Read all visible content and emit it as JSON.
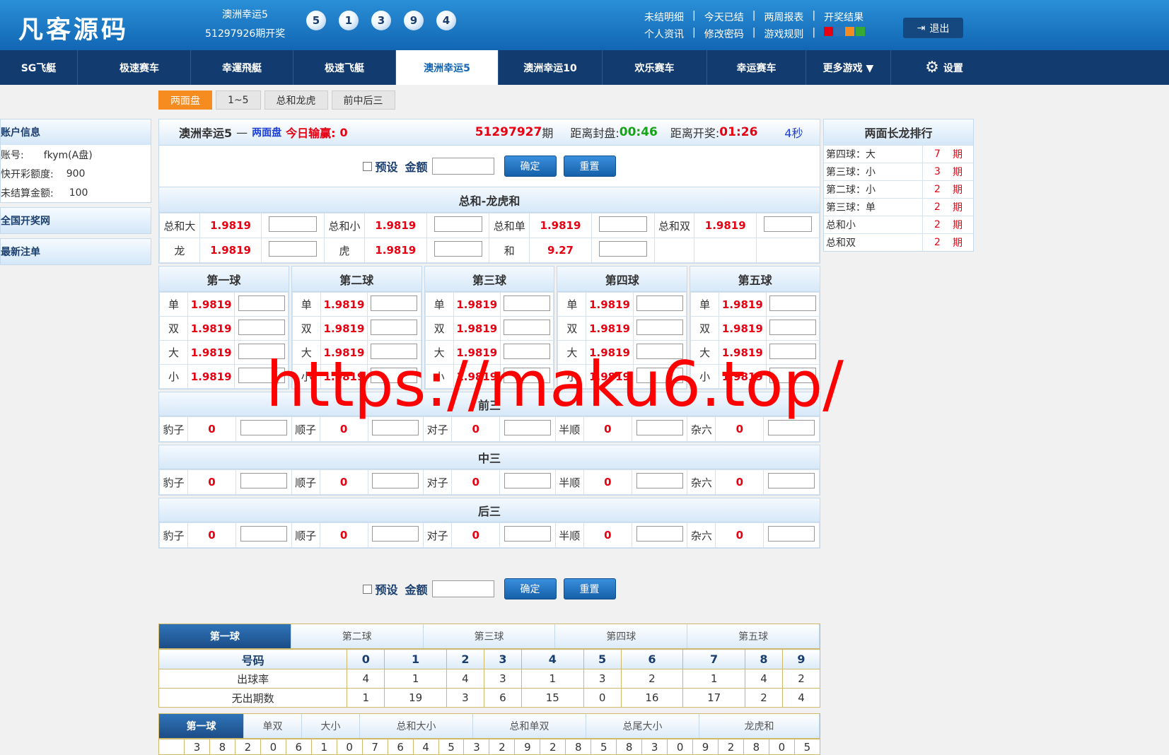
{
  "header": {
    "logo": "凡客源码",
    "lottery_name": "澳洲幸运5",
    "issue_text": "51297926期开奖",
    "balls": [
      "5",
      "1",
      "3",
      "9",
      "4"
    ],
    "links_row1": [
      "未结明细",
      "|",
      "今天已结",
      "|",
      "两周报表",
      "|",
      "开奖结果"
    ],
    "links_row2": [
      "个人资讯",
      "|",
      "修改密码",
      "|",
      "游戏规则",
      "|"
    ],
    "theme_colors": [
      "#e60012",
      "#2f74b9",
      "#f68b1f",
      "#39a935"
    ],
    "logout": "退出"
  },
  "nav": {
    "items": [
      "SG飞艇",
      "极速赛车",
      "幸運飛艇",
      "极速飞艇",
      "澳洲幸运5",
      "澳洲幸运10",
      "欢乐赛车",
      "幸运赛车",
      "更多游戏 ▼"
    ],
    "settings": "设置"
  },
  "subtabs": [
    "两面盘",
    "1~5",
    "总和龙虎",
    "前中后三"
  ],
  "left": {
    "account_title": "账户信息",
    "account_label": "账号:",
    "account_value": "fkym(A盘)",
    "credit_label": "快开彩额度:",
    "credit_value": "900",
    "unsettled_label": "未结算金额:",
    "unsettled_value": "100",
    "nav1": "全国开奖网",
    "nav2": "最新注单"
  },
  "main": {
    "game": "澳洲幸运5",
    "dash": "—",
    "mode": "两面盘",
    "today_label": "今日输赢:",
    "today_value": "0",
    "issue": "51297927",
    "issue_suffix": "期",
    "close_label": "距离封盘:",
    "close_time": "00:46",
    "draw_label": "距离开奖:",
    "draw_time": "01:26",
    "refresh": "4秒",
    "preset": "预设",
    "amount": "金额",
    "confirm": "确定",
    "reset": "重置"
  },
  "sum_section": {
    "title": "总和-龙虎和",
    "row1": [
      [
        "总和大",
        "1.9819"
      ],
      [
        "总和小",
        "1.9819"
      ],
      [
        "总和单",
        "1.9819"
      ],
      [
        "总和双",
        "1.9819"
      ]
    ],
    "row2": [
      [
        "龙",
        "1.9819"
      ],
      [
        "虎",
        "1.9819"
      ],
      [
        "和",
        "9.27"
      ]
    ]
  },
  "balls_section": {
    "titles": [
      "第一球",
      "第二球",
      "第三球",
      "第四球",
      "第五球"
    ],
    "labels": [
      "单",
      "双",
      "大",
      "小"
    ],
    "odds": "1.9819"
  },
  "three_sections": [
    {
      "title": "前三"
    },
    {
      "title": "中三"
    },
    {
      "title": "后三"
    }
  ],
  "three_items": [
    [
      "豹子",
      "0"
    ],
    [
      "顺子",
      "0"
    ],
    [
      "对子",
      "0"
    ],
    [
      "半顺",
      "0"
    ],
    [
      "杂六",
      "0"
    ]
  ],
  "long_dragon": {
    "title": "两面长龙排行",
    "rows": [
      [
        "第四球：大",
        "7",
        "期"
      ],
      [
        "第三球：小",
        "3",
        "期"
      ],
      [
        "第二球：小",
        "2",
        "期"
      ],
      [
        "第三球：单",
        "2",
        "期"
      ],
      [
        "总和小",
        "2",
        "期"
      ],
      [
        "总和双",
        "2",
        "期"
      ]
    ]
  },
  "stats": {
    "tabs": [
      "第一球",
      "第二球",
      "第三球",
      "第四球",
      "第五球"
    ],
    "header": [
      "号码",
      "0",
      "1",
      "2",
      "3",
      "4",
      "5",
      "6",
      "7",
      "8",
      "9"
    ],
    "rate_label": "出球率",
    "rate": [
      "4",
      "1",
      "4",
      "3",
      "1",
      "3",
      "2",
      "1",
      "4",
      "2"
    ],
    "miss_label": "无出期数",
    "miss": [
      "1",
      "19",
      "3",
      "6",
      "15",
      "0",
      "16",
      "17",
      "2",
      "4"
    ],
    "tabs2": [
      "第一球",
      "单双",
      "大小",
      "总和大小",
      "总和单双",
      "总尾大小",
      "龙虎和"
    ],
    "history": [
      "3",
      "8",
      "2",
      "0",
      "6",
      "1",
      "0",
      "7",
      "6",
      "4",
      "5",
      "3",
      "2",
      "9",
      "2",
      "8",
      "5",
      "8",
      "3",
      "0",
      "9",
      "2",
      "8",
      "0",
      "5"
    ]
  },
  "watermark": "https://maku6.top/"
}
